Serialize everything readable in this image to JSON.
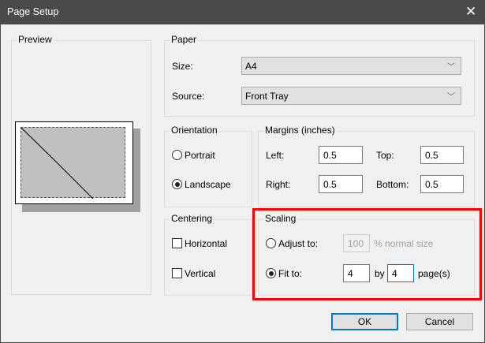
{
  "window": {
    "title": "Page Setup",
    "close_icon": "close-icon"
  },
  "preview": {
    "label": "Preview"
  },
  "paper": {
    "label": "Paper",
    "size_label": "Size:",
    "size_value": "A4",
    "source_label": "Source:",
    "source_value": "Front Tray"
  },
  "orientation": {
    "label": "Orientation",
    "portrait": "Portrait",
    "landscape": "Landscape",
    "selected": "landscape"
  },
  "margins": {
    "label": "Margins (inches)",
    "left_label": "Left:",
    "left": "0.5",
    "top_label": "Top:",
    "top": "0.5",
    "right_label": "Right:",
    "right": "0.5",
    "bottom_label": "Bottom:",
    "bottom": "0.5"
  },
  "centering": {
    "label": "Centering",
    "horizontal": "Horizontal",
    "vertical": "Vertical",
    "horizontal_checked": false,
    "vertical_checked": false
  },
  "scaling": {
    "label": "Scaling",
    "adjust_label": "Adjust to:",
    "adjust_value": "100",
    "adjust_suffix": "% normal size",
    "fit_label": "Fit to:",
    "fit_wide": "4",
    "by_label": "by",
    "fit_tall": "4",
    "pages_suffix": "page(s)",
    "selected": "fit"
  },
  "highlight_color": "#ff0000",
  "buttons": {
    "ok": "OK",
    "cancel": "Cancel"
  }
}
